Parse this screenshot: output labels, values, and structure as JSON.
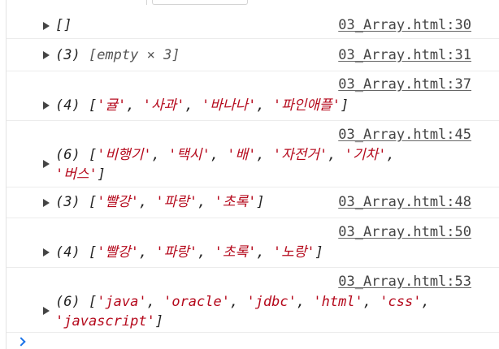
{
  "console": {
    "messages": [
      {
        "source": "03_Array.html:30",
        "lines": [
          [
            {
              "t": "[]",
              "c": "punc"
            }
          ]
        ]
      },
      {
        "source": "03_Array.html:31",
        "lines": [
          [
            {
              "t": "(3) ",
              "c": "punc"
            },
            {
              "t": "[empty × 3]",
              "c": "meta"
            }
          ]
        ]
      },
      {
        "source": "03_Array.html:37",
        "lines": [
          [
            {
              "t": "(4) [",
              "c": "punc"
            },
            {
              "t": "'귤'",
              "c": "str"
            },
            {
              "t": ", ",
              "c": "punc"
            },
            {
              "t": "'사과'",
              "c": "str"
            },
            {
              "t": ", ",
              "c": "punc"
            },
            {
              "t": "'바나나'",
              "c": "str"
            },
            {
              "t": ", ",
              "c": "punc"
            },
            {
              "t": "'파인애플'",
              "c": "str"
            },
            {
              "t": "]",
              "c": "punc"
            }
          ]
        ]
      },
      {
        "source": "03_Array.html:45",
        "lines": [
          [
            {
              "t": "(6) [",
              "c": "punc"
            },
            {
              "t": "'비행기'",
              "c": "str"
            },
            {
              "t": ", ",
              "c": "punc"
            },
            {
              "t": "'택시'",
              "c": "str"
            },
            {
              "t": ", ",
              "c": "punc"
            },
            {
              "t": "'배'",
              "c": "str"
            },
            {
              "t": ", ",
              "c": "punc"
            },
            {
              "t": "'자전거'",
              "c": "str"
            },
            {
              "t": ", ",
              "c": "punc"
            },
            {
              "t": "'기차'",
              "c": "str"
            },
            {
              "t": ",",
              "c": "punc"
            }
          ],
          [
            {
              "t": "'버스'",
              "c": "str"
            },
            {
              "t": "]",
              "c": "punc"
            }
          ]
        ]
      },
      {
        "source": "03_Array.html:48",
        "lines": [
          [
            {
              "t": "(3) [",
              "c": "punc"
            },
            {
              "t": "'빨강'",
              "c": "str"
            },
            {
              "t": ", ",
              "c": "punc"
            },
            {
              "t": "'파랑'",
              "c": "str"
            },
            {
              "t": ", ",
              "c": "punc"
            },
            {
              "t": "'초록'",
              "c": "str"
            },
            {
              "t": "]",
              "c": "punc"
            }
          ]
        ]
      },
      {
        "source": "03_Array.html:50",
        "lines": [
          [
            {
              "t": "(4) [",
              "c": "punc"
            },
            {
              "t": "'빨강'",
              "c": "str"
            },
            {
              "t": ", ",
              "c": "punc"
            },
            {
              "t": "'파랑'",
              "c": "str"
            },
            {
              "t": ", ",
              "c": "punc"
            },
            {
              "t": "'초록'",
              "c": "str"
            },
            {
              "t": ", ",
              "c": "punc"
            },
            {
              "t": "'노랑'",
              "c": "str"
            },
            {
              "t": "]",
              "c": "punc"
            }
          ]
        ]
      },
      {
        "source": "03_Array.html:53",
        "lines": [
          [
            {
              "t": "(6) [",
              "c": "punc"
            },
            {
              "t": "'java'",
              "c": "str"
            },
            {
              "t": ", ",
              "c": "punc"
            },
            {
              "t": "'oracle'",
              "c": "str"
            },
            {
              "t": ", ",
              "c": "punc"
            },
            {
              "t": "'jdbc'",
              "c": "str"
            },
            {
              "t": ", ",
              "c": "punc"
            },
            {
              "t": "'html'",
              "c": "str"
            },
            {
              "t": ", ",
              "c": "punc"
            },
            {
              "t": "'css'",
              "c": "str"
            },
            {
              "t": ",",
              "c": "punc"
            }
          ],
          [
            {
              "t": "'javascript'",
              "c": "str"
            },
            {
              "t": "]",
              "c": "punc"
            }
          ]
        ]
      }
    ],
    "icons": {
      "expand": "expand-triangle-icon",
      "prompt": "chevron-right-prompt-icon"
    },
    "colors": {
      "string": "#b5091c",
      "link": "#444444",
      "prompt": "#1a73e8",
      "divider": "#ececec"
    }
  }
}
